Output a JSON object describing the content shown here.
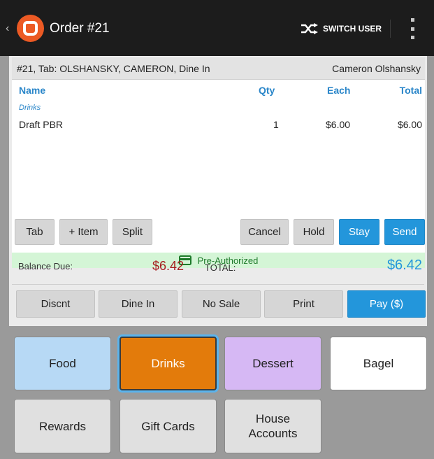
{
  "app_bar": {
    "title": "Order #21",
    "switch_user_label": "SWITCH USER",
    "icons": [
      "back-chevron-icon",
      "app-logo-icon",
      "shuffle-icon",
      "overflow-menu-icon"
    ]
  },
  "order": {
    "tab_info": "#21, Tab: OLSHANSKY, CAMERON, Dine In",
    "server_name": "Cameron Olshansky",
    "columns": {
      "name": "Name",
      "qty": "Qty",
      "each": "Each",
      "total": "Total"
    },
    "category": "Drinks",
    "items": [
      {
        "name": "Draft PBR",
        "qty": "1",
        "each": "$6.00",
        "total": "$6.00"
      }
    ],
    "preauth_label": "Pre-Authorized"
  },
  "actions_row": {
    "tab": "Tab",
    "add_item": "+ Item",
    "split": "Split",
    "cancel": "Cancel",
    "hold": "Hold",
    "stay": "Stay",
    "send": "Send"
  },
  "totals": {
    "balance_label": "Balance Due:",
    "balance_value": "$6.42",
    "total_label": "TOTAL:",
    "total_value": "$6.42"
  },
  "bottom_row": {
    "discount": "Discnt",
    "dine_in": "Dine In",
    "no_sale": "No Sale",
    "print": "Print",
    "pay": "Pay ($)"
  },
  "categories": {
    "food": "Food",
    "drinks": "Drinks",
    "dessert": "Dessert",
    "bagel": "Bagel",
    "rewards": "Rewards",
    "gift_cards": "Gift Cards",
    "house_accounts_line1": "House",
    "house_accounts_line2": "Accounts"
  },
  "colors": {
    "app_bar": "#1c1c1c",
    "brand_orange": "#ec5a24",
    "accent_blue": "#2396db",
    "balance_red": "#a61e1e",
    "preauth_green_bg": "#d4f5d6",
    "selected_category": "#e37b0b"
  }
}
